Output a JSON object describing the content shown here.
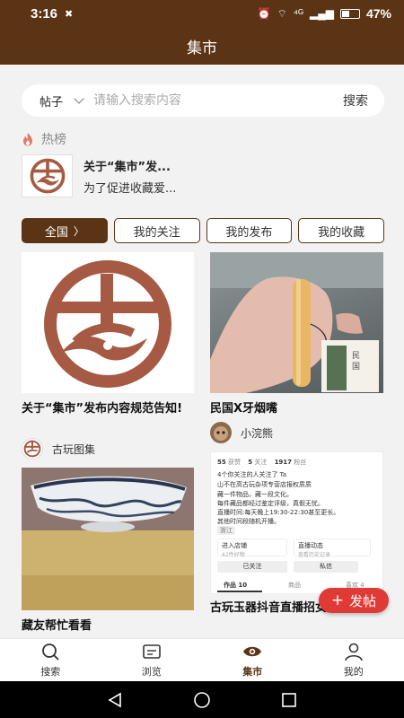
{
  "status_bar": {
    "time": "3:16",
    "signal_text": "⁴ᴳ",
    "battery_percent": "47%",
    "battery_level": 0.47
  },
  "header": {
    "title": "集市"
  },
  "search": {
    "type_label": "帖子",
    "placeholder": "请输入搜索内容",
    "button_label": "搜索"
  },
  "hot": {
    "label": "热榜",
    "item": {
      "title": "关于“集市”发...",
      "desc": "为了促进收藏爱..."
    }
  },
  "tabs": [
    {
      "label": "全国",
      "active": true
    },
    {
      "label": "我的关注",
      "active": false
    },
    {
      "label": "我的发布",
      "active": false
    },
    {
      "label": "我的收藏",
      "active": false
    }
  ],
  "posts": [
    {
      "title": "关于“集市”发布内容规范告知!",
      "author": "古玩图集",
      "image": "logo"
    },
    {
      "title": "民国X牙烟嘴",
      "author": "小浣熊",
      "image": "cigarette-holder"
    },
    {
      "title": "藏友帮忙看看",
      "author": "",
      "image": "porcelain-bowl"
    },
    {
      "title": "古玩玉器抖音直播招女主播场",
      "author": "",
      "image": "profile-screenshot"
    }
  ],
  "screenshot_card": {
    "follow_count": "55",
    "follow_label": "获赞",
    "fans_count": "5",
    "fans_label": "关注",
    "likes_count": "1917",
    "likes_label": "粉丝",
    "line1": "4个你关注的人关注了 Ta",
    "line2": "山不在高古玩杂项专营店报权质质",
    "line3": "藏一件物品，藏一段文化。",
    "line4": "每件藏品都经过鉴定评级，真假无忧。",
    "line5": "直播时间:每天晚上19:30-22:30甚至更长。",
    "line6": "其他时间段随机开播。",
    "location": "浙江",
    "btn1": "进入店铺",
    "btn1_sub": "42件好物",
    "btn2": "直播动态",
    "btn2_sub": "查看历史记录",
    "followed": "已关注",
    "message": "私信",
    "tab_works": "作品 10",
    "tab_goods": "商品",
    "tab_likes": "喜欢 4"
  },
  "fab": {
    "label": "发帖",
    "plus": "+"
  },
  "bottom_nav": [
    {
      "label": "搜索",
      "icon": "search-icon",
      "active": false
    },
    {
      "label": "浏览",
      "icon": "browse-icon",
      "active": false
    },
    {
      "label": "集市",
      "icon": "market-icon",
      "active": true
    },
    {
      "label": "我的",
      "icon": "profile-icon",
      "active": false
    }
  ],
  "colors": {
    "brand": "#5b3415",
    "logo": "#a65a44",
    "fab": "#e03a36"
  }
}
